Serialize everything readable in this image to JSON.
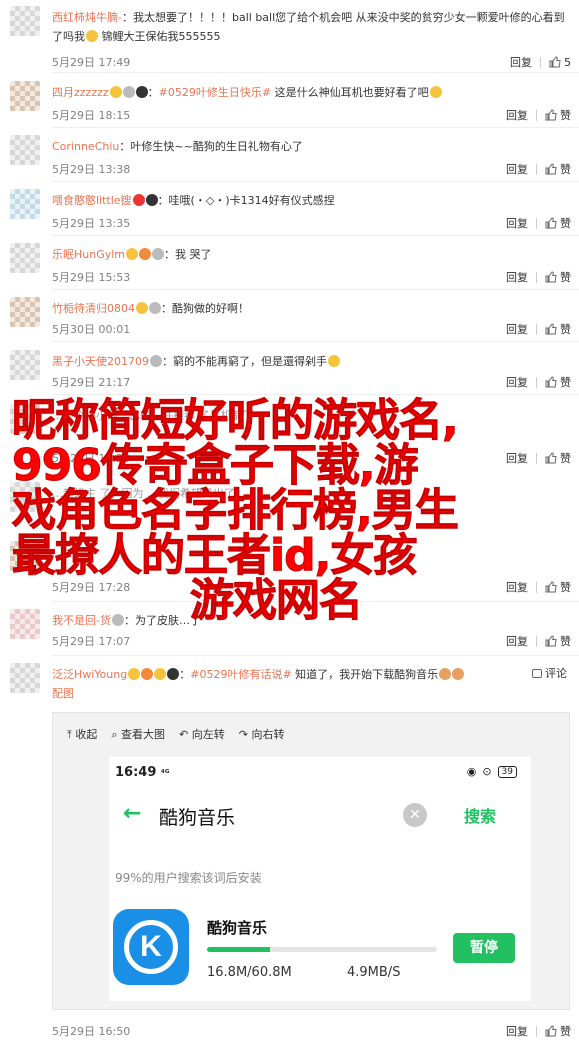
{
  "comments": [
    {
      "user": "西红柿炖牛腩-",
      "text": "：我太想要了！！！！ball  ball您了给个机会吧 从来没中奖的贫穷少女一颗爱叶修的心看到了吗我",
      "tail": " 锦鲤大王保佑我555555",
      "time": "5月29日 17:49",
      "reply": "回复",
      "likes": "5"
    },
    {
      "user": "四月zzzzzz",
      "pre": "：",
      "tag": "#0529叶修生日快乐#",
      "text": " 这是什么神仙耳机也要好看了吧",
      "time": "5月29日 18:15",
      "reply": "回复",
      "likes": "赞"
    },
    {
      "user": "CorinneChiu",
      "text": "：叶修生快~~酷狗的生日礼物有心了",
      "time": "5月29日 13:38",
      "reply": "回复",
      "likes": "赞"
    },
    {
      "user": "喂食憨憨little锼",
      "text": "：哇哦(・◇・)卡1314好有仪式感捏",
      "time": "5月29日 13:35",
      "reply": "回复",
      "likes": "赞"
    },
    {
      "user": "乐眠HunGylm",
      "text": "：我    哭了",
      "time": "5月29日 15:53",
      "reply": "回复",
      "likes": "赞"
    },
    {
      "user": "竹栀待清归0804",
      "text": "：酷狗做的好啊！",
      "time": "5月30日 00:01",
      "reply": "回复",
      "likes": "赞"
    },
    {
      "user": "黑子小天使201709",
      "text": "：窮的不能再窮了，但是還得剁手",
      "time": "5月29日 21:17",
      "reply": "回复",
      "likes": "赞"
    },
    {
      "user": "",
      "text": "…一个小小的…比较…并推荐 了手机都下",
      "time": "5月29日 19:20",
      "reply": "回复",
      "likes": "赞"
    },
    {
      "user": "",
      "text": "…超级主 了，因为 …我们希望又出了，",
      "time": "",
      "reply": "",
      "likes": ""
    },
    {
      "user": "",
      "text": "",
      "time": "5月29日 17:28",
      "reply": "回复",
      "likes": "赞"
    },
    {
      "user": "我不是回-货",
      "text": "：为了皮肤…了",
      "time": "5月29日 17:07",
      "reply": "回复",
      "likes": "赞"
    },
    {
      "user": "泛泛HwiYoung",
      "pre": "：",
      "tag": "#0529叶修有话说#",
      "text": " 知道了，我开始下载酷狗音乐",
      "tail_link": "配图",
      "time": "5月29日 16:50",
      "reply": "回复",
      "likes": "赞",
      "comment_label": "评论"
    }
  ],
  "headline": {
    "lines": [
      "昵称简短好听的游戏名,",
      "996传奇盒子下载,游",
      "戏角色名字排行榜,男生",
      "最撩人的王者id,女孩",
      "游戏网名"
    ]
  },
  "embed": {
    "toolbar": [
      "⤒ 收起",
      "⌕ 查看大图",
      "↶ 向左转",
      "↷ 向右转"
    ],
    "status_time": "16:49",
    "status_net": "⁴ᴳ",
    "battery": "39",
    "search_value": "酷狗音乐",
    "search_button": "搜索",
    "hint": "99%的用户搜索该词后安装",
    "app": {
      "name": "酷狗音乐",
      "icon_letter": "K",
      "size": "16.8M/60.8M",
      "speed": "4.9MB/S",
      "progress": 0.276,
      "action": "暂停"
    }
  },
  "colors": {
    "username": "#eb7350",
    "headline": "#ff0000",
    "accent": "#21c162",
    "app_icon": "#1a8fe6"
  }
}
